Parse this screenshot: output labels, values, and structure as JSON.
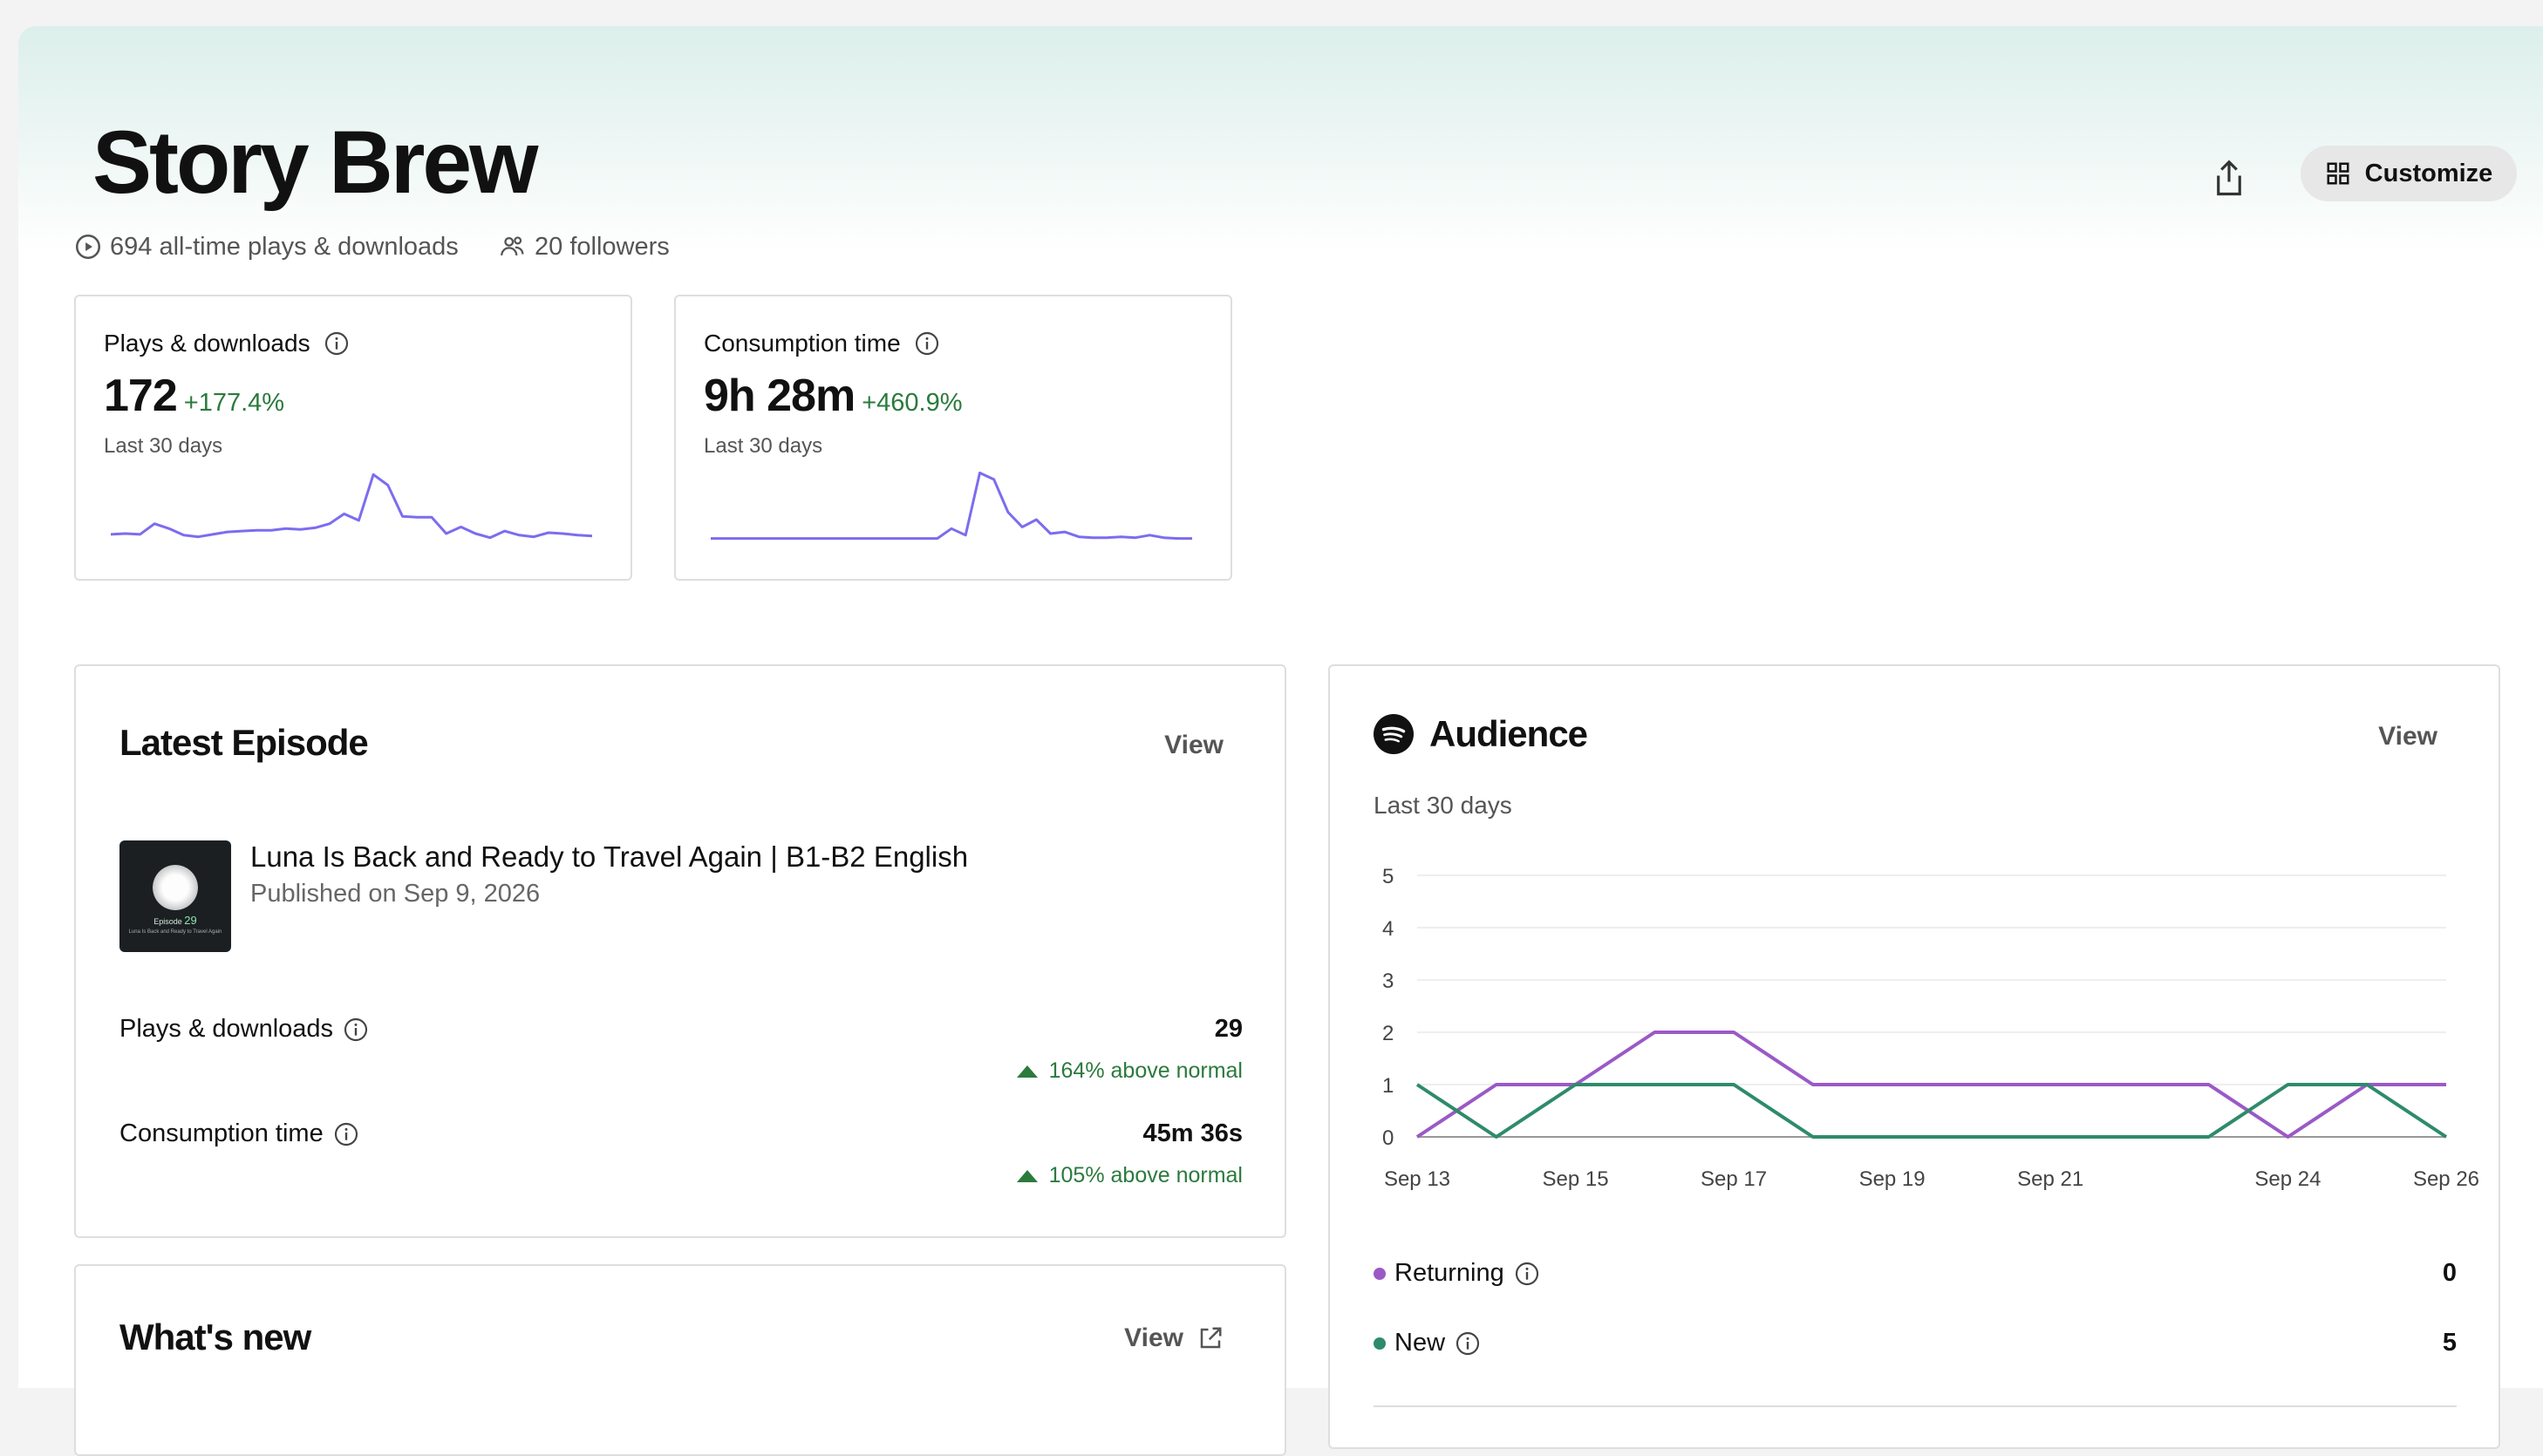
{
  "show": {
    "title": "Story Brew",
    "plays_summary": "694 all-time plays & downloads",
    "followers": "20 followers"
  },
  "toolbar": {
    "customize_label": "Customize"
  },
  "stats": [
    {
      "label": "Plays & downloads",
      "value": "172",
      "change": "+177.4%",
      "period": "Last 30 days",
      "trend": [
        1.5,
        1.6,
        1.5,
        2.8,
        2.2,
        1.4,
        1.2,
        1.5,
        1.8,
        1.9,
        2.0,
        2.0,
        2.2,
        2.1,
        2.3,
        2.8,
        4.0,
        3.2,
        8.8,
        7.5,
        3.7,
        3.6,
        3.6,
        1.6,
        2.4,
        1.6,
        1.1,
        1.9,
        1.4,
        1.2,
        1.7,
        1.6,
        1.4,
        1.3
      ]
    },
    {
      "label": "Consumption time",
      "value": "9h 28m",
      "change": "+460.9%",
      "period": "Last 30 days",
      "trend": [
        1.0,
        1.0,
        1.0,
        1.0,
        1.0,
        1.0,
        1.0,
        1.0,
        1.0,
        1.0,
        1.0,
        1.0,
        1.0,
        1.0,
        1.0,
        1.0,
        1.0,
        2.2,
        1.4,
        9.0,
        8.2,
        4.2,
        2.4,
        3.3,
        1.6,
        1.8,
        1.2,
        1.1,
        1.1,
        1.2,
        1.1,
        1.4,
        1.1,
        1.0,
        1.0
      ]
    }
  ],
  "latest_episode": {
    "heading": "Latest Episode",
    "view_label": "View",
    "title": "Luna Is Back and Ready to Travel Again | B1-B2 English",
    "published": "Published on Sep 9, 2026",
    "thumb_episode_label": "Episode",
    "thumb_episode_number": "29",
    "thumb_caption": "Luna Is Back and Ready to Travel Again",
    "rows": [
      {
        "label": "Plays & downloads",
        "value": "29",
        "change": "164% above normal"
      },
      {
        "label": "Consumption time",
        "value": "45m 36s",
        "change": "105% above normal"
      }
    ]
  },
  "whats_new": {
    "heading": "What's new",
    "view_label": "View"
  },
  "audience": {
    "heading": "Audience",
    "period": "Last 30 days",
    "view_label": "View",
    "legend": [
      {
        "label": "Returning",
        "value": "0",
        "color": "#9b59c7"
      },
      {
        "label": "New",
        "value": "5",
        "color": "#2e8b6a"
      }
    ]
  },
  "chart_data": {
    "type": "line",
    "y_ticks": [
      "0",
      "1",
      "2",
      "3",
      "4",
      "5"
    ],
    "ylim": [
      0,
      5
    ],
    "x_tick_labels": [
      {
        "label": "Sep 13",
        "date": "2026-09-13"
      },
      {
        "label": "Sep 15",
        "date": "2026-09-15"
      },
      {
        "label": "Sep 17",
        "date": "2026-09-17"
      },
      {
        "label": "Sep 19",
        "date": "2026-09-19"
      },
      {
        "label": "Sep 21",
        "date": "2026-09-21"
      },
      {
        "label": "Sep 24",
        "date": "2026-09-24"
      },
      {
        "label": "Sep 26",
        "date": "2026-09-26"
      }
    ],
    "x": [
      "2026-09-13",
      "2026-09-14",
      "2026-09-15",
      "2026-09-16",
      "2026-09-17",
      "2026-09-18",
      "2026-09-19",
      "2026-09-20",
      "2026-09-21",
      "2026-09-22",
      "2026-09-23",
      "2026-09-24",
      "2026-09-25",
      "2026-09-26"
    ],
    "series": [
      {
        "name": "Returning",
        "color": "#9b59c7",
        "values": [
          0,
          1,
          1,
          2,
          2,
          1,
          1,
          1,
          1,
          1,
          1,
          0,
          1,
          1
        ]
      },
      {
        "name": "New",
        "color": "#2e8b6a",
        "values": [
          1,
          0,
          1,
          1,
          1,
          0,
          0,
          0,
          0,
          0,
          0,
          1,
          1,
          0
        ]
      }
    ]
  }
}
